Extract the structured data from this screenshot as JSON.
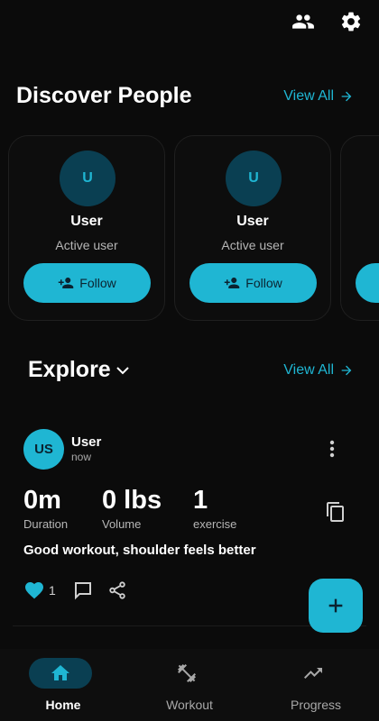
{
  "colors": {
    "accent": "#1fb6d3",
    "accent_dark": "#0a3f52",
    "background": "#0b0b0b"
  },
  "topbar": {
    "icons": [
      "people-icon",
      "gear-icon"
    ]
  },
  "discover": {
    "title": "Discover People",
    "view_all": "View All",
    "cards": [
      {
        "initial": "U",
        "name": "User",
        "status": "Active user",
        "follow_label": "Follow"
      },
      {
        "initial": "U",
        "name": "User",
        "status": "Active user",
        "follow_label": "Follow"
      }
    ]
  },
  "explore": {
    "title": "Explore",
    "view_all": "View All",
    "post": {
      "avatar": "US",
      "user": "User",
      "time": "now",
      "stats": [
        {
          "value": "0m",
          "label": "Duration"
        },
        {
          "value": "0 lbs",
          "label": "Volume"
        },
        {
          "value": "1",
          "label": "exercise"
        }
      ],
      "note": "Good workout, shoulder feels better",
      "likes": "1"
    }
  },
  "nav": {
    "items": [
      {
        "label": "Home",
        "icon": "home-icon"
      },
      {
        "label": "Workout",
        "icon": "dumbbell-icon"
      },
      {
        "label": "Progress",
        "icon": "trending-up-icon"
      }
    ]
  }
}
